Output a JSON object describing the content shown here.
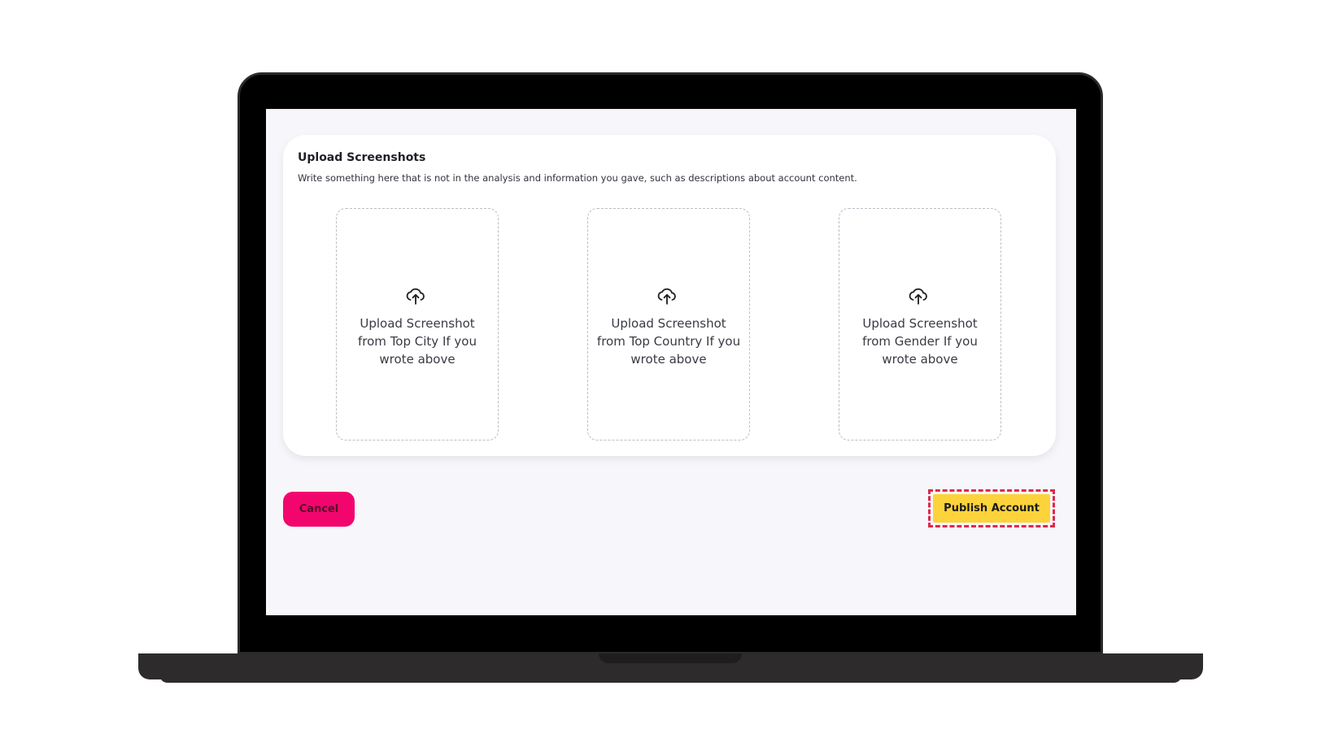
{
  "upload_section": {
    "title": "Upload Screenshots",
    "description": "Write something here that is not in the analysis and information you gave, such as descriptions about account content.",
    "boxes": [
      {
        "label": "Upload Screenshot from Top City If you wrote above",
        "icon": "cloud-upload-icon"
      },
      {
        "label": "Upload Screenshot from Top Country If you wrote above",
        "icon": "cloud-upload-icon"
      },
      {
        "label": "Upload Screenshot from Gender If you wrote above",
        "icon": "cloud-upload-icon"
      }
    ]
  },
  "actions": {
    "cancel_label": "Cancel",
    "publish_label": "Publish Account"
  },
  "colors": {
    "cancel_bg": "#f2066e",
    "publish_bg": "#fdd33b",
    "highlight_border": "#e0284a",
    "screen_bg": "#f7f7fb"
  }
}
